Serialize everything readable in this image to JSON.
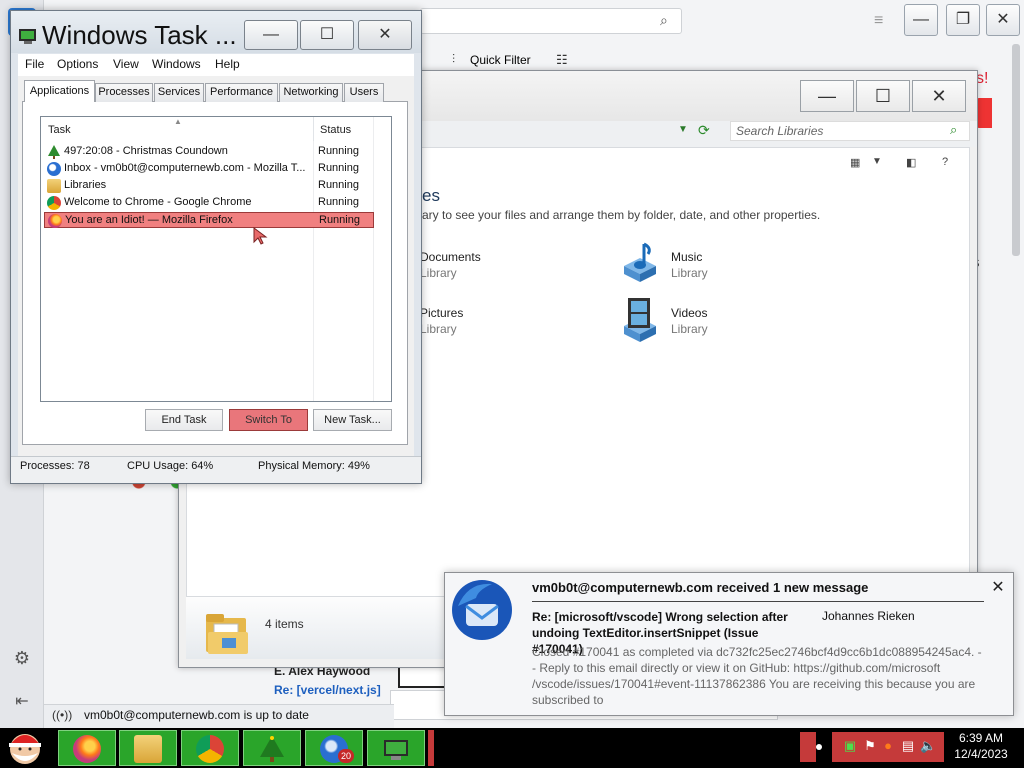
{
  "thunderbird": {
    "quick_filter_label": "Quick Filter",
    "message_author": "E. Alex Haywood",
    "message_subject": "Re: [vercel/next.js]",
    "status_text": "vm0b0t@computernewb.com is up to date",
    "red_label_fragment": "s!",
    "side_letter": "s"
  },
  "libraries": {
    "search_placeholder": "Search Libraries",
    "heading_fragment": "es",
    "description_fragment": "ary to see your files and arrange them by folder, date, and other properties.",
    "items": [
      {
        "name": "Documents",
        "type": "Library"
      },
      {
        "name": "Music",
        "type": "Library"
      },
      {
        "name": "Pictures",
        "type": "Library"
      },
      {
        "name": "Videos",
        "type": "Library"
      }
    ],
    "details_count": "4 items"
  },
  "task_manager": {
    "title": "Windows Task ...",
    "menu": [
      "File",
      "Options",
      "View",
      "Windows",
      "Help"
    ],
    "tabs": [
      "Applications",
      "Processes",
      "Services",
      "Performance",
      "Networking",
      "Users"
    ],
    "columns": {
      "task": "Task",
      "status": "Status"
    },
    "tasks": [
      {
        "name": "497:20:08 - Christmas Coundown",
        "status": "Running",
        "icon": "christmas-tree-icon",
        "color": "#2e8b2e"
      },
      {
        "name": "Inbox - vm0b0t@computernewb.com - Mozilla T...",
        "status": "Running",
        "icon": "thunderbird-icon",
        "color": "#2a6fd1"
      },
      {
        "name": "Libraries",
        "status": "Running",
        "icon": "libraries-folder-icon",
        "color": "#e0b64a"
      },
      {
        "name": "Welcome to Chrome - Google Chrome",
        "status": "Running",
        "icon": "chrome-icon",
        "color": "#db4437"
      },
      {
        "name": "You are an Idiot! — Mozilla Firefox",
        "status": "Running",
        "icon": "firefox-icon",
        "color": "#ff7a1a",
        "selected": true
      }
    ],
    "buttons": {
      "end_task": "End Task",
      "switch_to": "Switch To",
      "new_task": "New Task..."
    },
    "status": {
      "processes": "Processes: 78",
      "cpu": "CPU Usage: 64%",
      "memory": "Physical Memory: 49%"
    }
  },
  "notification": {
    "title": "vm0b0t@computernewb.com received 1 new message",
    "subject": "Re: [microsoft/vscode] Wrong selection after undoing TextEditor.insertSnippet (Issue #170041)",
    "sender": "Johannes Rieken",
    "body": "Closed #170041 as completed via dc732fc25ec2746bcf4d9cc6b1dc088954245ac4. -- Reply to this email directly or view it on GitHub: https://github.com/microsoft /vscode/issues/170041#event-11137862386 You are receiving this because you are subscribed to"
  },
  "taskbar": {
    "apps": [
      "firefox-icon",
      "explorer-icon",
      "chrome-icon",
      "christmas-tree-icon",
      "thunderbird-icon",
      "task-manager-icon"
    ],
    "thunderbird_badge": "20",
    "clock_time": "6:39 AM",
    "clock_date": "12/4/2023"
  },
  "colors": {
    "selection": "#f08080",
    "taskbar_task": "#2aa52a",
    "tray": "#c53a3a",
    "accent_blue": "#2a6fd1"
  }
}
